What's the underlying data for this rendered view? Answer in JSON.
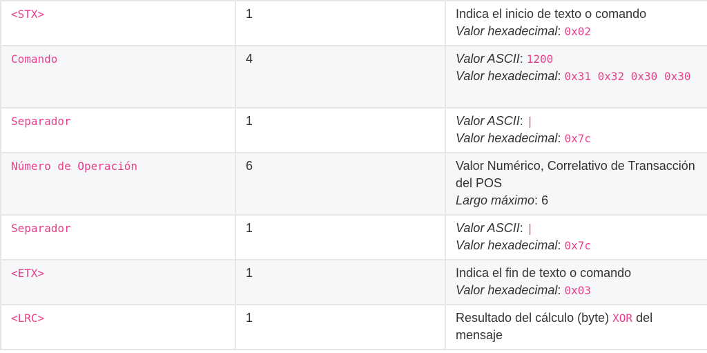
{
  "colors": {
    "code": "#e83e8c",
    "text": "#333333",
    "border": "#e6e6e6",
    "row_alt": "#f6f7f9"
  },
  "labels": {
    "hex": "Valor hexadecimal",
    "ascii": "Valor ASCII",
    "colon": ":",
    "max_len": "Largo máximo"
  },
  "rows": [
    {
      "field": "<STX>",
      "length": "1",
      "desc": "Indica el inicio de texto o comando",
      "hex": "0x02"
    },
    {
      "field": "Comando",
      "length": "4",
      "ascii": "1200",
      "hex": "0x31 0x32 0x30 0x30"
    },
    {
      "field": "Separador",
      "length": "1",
      "ascii": "|",
      "hex": "0x7c"
    },
    {
      "field": "Número de Operación",
      "length": "6",
      "desc": "Valor Numérico, Correlativo de Transacción del POS",
      "max_len": "6"
    },
    {
      "field": "Separador",
      "length": "1",
      "ascii": "|",
      "hex": "0x7c"
    },
    {
      "field": "<ETX>",
      "length": "1",
      "desc": "Indica el fin de texto o comando",
      "hex": "0x03"
    },
    {
      "field": "<LRC>",
      "length": "1",
      "desc_pre": "Resultado del cálculo (byte)",
      "desc_code": "XOR",
      "desc_post": "del mensaje"
    }
  ]
}
